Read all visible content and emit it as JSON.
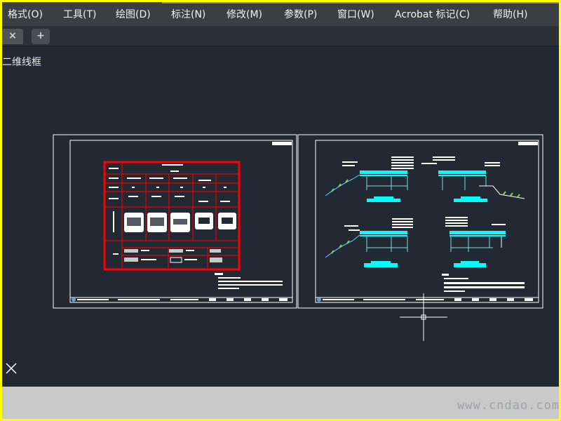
{
  "menu": {
    "items": [
      {
        "label": "格式(O)"
      },
      {
        "label": "工具(T)"
      },
      {
        "label": "绘图(D)"
      },
      {
        "label": "标注(N)"
      },
      {
        "label": "修改(M)"
      },
      {
        "label": "参数(P)"
      },
      {
        "label": "窗口(W)"
      },
      {
        "label": "Acrobat 标记(C)"
      },
      {
        "label": "帮助(H)"
      }
    ]
  },
  "tabs": {
    "close_glyph": "×",
    "add_glyph": "+"
  },
  "viewport": {
    "label": "二维线框"
  },
  "colors": {
    "frame_border": "#ffff00",
    "canvas_bg": "#222933",
    "highlight": "#ff0000",
    "accent_cyan": "#00ffff"
  },
  "watermark": "www.cndao.com"
}
